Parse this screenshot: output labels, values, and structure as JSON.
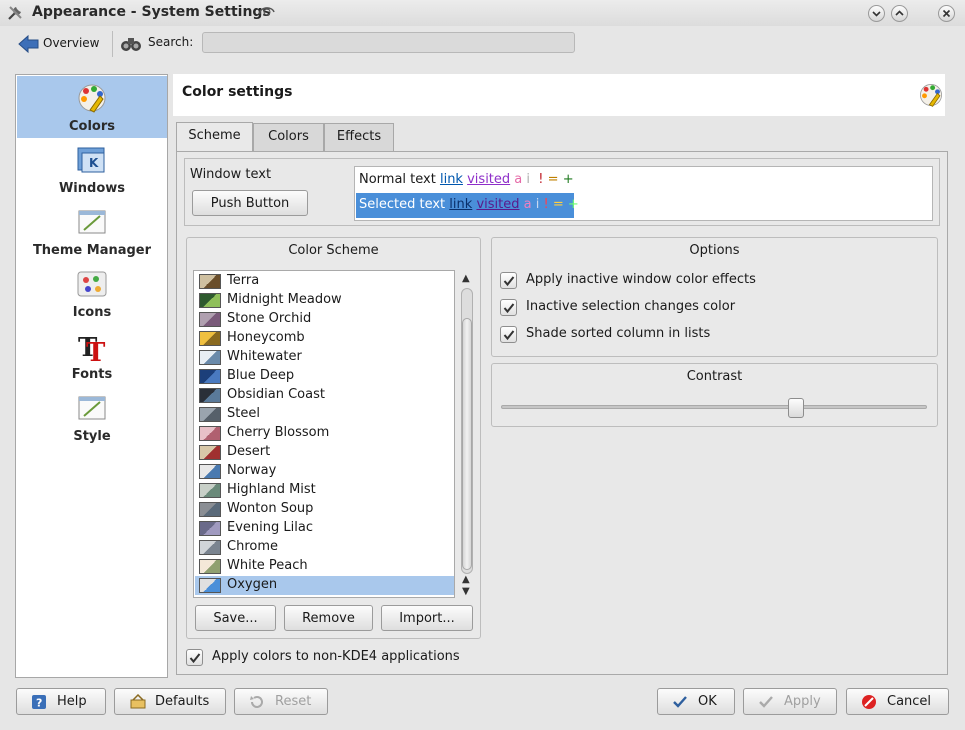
{
  "window": {
    "title": "Appearance - System Settings"
  },
  "toolbar": {
    "overview_label": "Overview",
    "search_label": "Search:",
    "search_value": ""
  },
  "sidebar": {
    "items": [
      {
        "label": "Colors",
        "icon": "palette-icon",
        "active": true
      },
      {
        "label": "Windows",
        "icon": "windows-icon",
        "active": false
      },
      {
        "label": "Theme Manager",
        "icon": "theme-manager-icon",
        "active": false
      },
      {
        "label": "Icons",
        "icon": "icons-icon",
        "active": false
      },
      {
        "label": "Fonts",
        "icon": "fonts-icon",
        "active": false
      },
      {
        "label": "Style",
        "icon": "style-icon",
        "active": false
      }
    ]
  },
  "header": {
    "title": "Color settings"
  },
  "tabs": [
    {
      "label": "Scheme",
      "active": true
    },
    {
      "label": "Colors",
      "active": false
    },
    {
      "label": "Effects",
      "active": false
    }
  ],
  "preview": {
    "window_text_label": "Window text",
    "push_button_label": "Push Button",
    "normal": {
      "text": "Normal text",
      "link": "link",
      "visited": "visited",
      "active": "a",
      "inactive": "i",
      "negative": "!",
      "neutral": "=",
      "positive": "+"
    },
    "selected": {
      "text": "Selected text",
      "link": "link",
      "visited": "visited",
      "active": "a",
      "inactive": "i",
      "negative": "!",
      "neutral": "=",
      "positive": "+"
    }
  },
  "color_scheme": {
    "title": "Color Scheme",
    "schemes": [
      {
        "name": "Terra",
        "colors": [
          "#cfc0a0",
          "#6a4e2a"
        ]
      },
      {
        "name": "Midnight Meadow",
        "colors": [
          "#2e5a2e",
          "#8fbf5a"
        ]
      },
      {
        "name": "Stone Orchid",
        "colors": [
          "#b0a0b0",
          "#7a5a7a"
        ]
      },
      {
        "name": "Honeycomb",
        "colors": [
          "#f0c040",
          "#8a6a20"
        ]
      },
      {
        "name": "Whitewater",
        "colors": [
          "#e8eef4",
          "#6a8aaa"
        ]
      },
      {
        "name": "Blue Deep",
        "colors": [
          "#1c3f7a",
          "#4a7ac0"
        ]
      },
      {
        "name": "Obsidian Coast",
        "colors": [
          "#2a2f38",
          "#5a7a9a"
        ]
      },
      {
        "name": "Steel",
        "colors": [
          "#9aa4ae",
          "#56606a"
        ]
      },
      {
        "name": "Cherry Blossom",
        "colors": [
          "#e8c0c8",
          "#b06070"
        ]
      },
      {
        "name": "Desert",
        "colors": [
          "#d8c8a8",
          "#a03030"
        ]
      },
      {
        "name": "Norway",
        "colors": [
          "#e8e8e8",
          "#4a7ab0"
        ]
      },
      {
        "name": "Highland Mist",
        "colors": [
          "#c8d0c8",
          "#6a8a7a"
        ]
      },
      {
        "name": "Wonton Soup",
        "colors": [
          "#8a8e94",
          "#5a6a7a"
        ]
      },
      {
        "name": "Evening Lilac",
        "colors": [
          "#6a6a8a",
          "#a09ac0"
        ]
      },
      {
        "name": "Chrome",
        "colors": [
          "#d0d4d8",
          "#7a8490"
        ]
      },
      {
        "name": "White Peach",
        "colors": [
          "#f4e8d8",
          "#90a070"
        ]
      },
      {
        "name": "Oxygen",
        "colors": [
          "#e0e0e0",
          "#4a8fd9"
        ]
      }
    ],
    "selected_index": 16,
    "save_label": "Save...",
    "remove_label": "Remove",
    "import_label": "Import..."
  },
  "options": {
    "title": "Options",
    "items": [
      {
        "label": "Apply inactive window color effects",
        "checked": true
      },
      {
        "label": "Inactive selection changes color",
        "checked": true
      },
      {
        "label": "Shade sorted column in lists",
        "checked": true
      }
    ]
  },
  "contrast": {
    "title": "Contrast",
    "value": 7,
    "max": 10
  },
  "apply_non_kde": {
    "label": "Apply colors to non-KDE4 applications",
    "checked": true
  },
  "buttons": {
    "help": "Help",
    "defaults": "Defaults",
    "reset": "Reset",
    "ok": "OK",
    "apply": "Apply",
    "cancel": "Cancel"
  },
  "colors": {
    "selection": "#a9c8ec",
    "highlight": "#4a8fd9",
    "link": "#0057ae",
    "visited": "#8e2ec9"
  }
}
